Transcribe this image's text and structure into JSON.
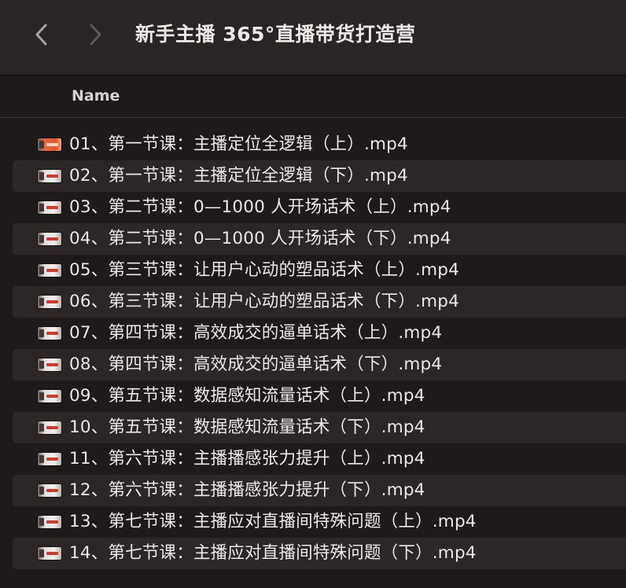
{
  "window": {
    "title": "新手主播 365°直播带货打造营"
  },
  "toolbar": {
    "back_icon": "chevron-left-icon",
    "forward_icon": "chevron-right-icon"
  },
  "columns": {
    "name_label": "Name"
  },
  "files": [
    {
      "name": "01、第一节课：主播定位全逻辑（上）.mp4"
    },
    {
      "name": "02、第一节课：主播定位全逻辑（下）.mp4"
    },
    {
      "name": "03、第二节课：0—1000 人开场话术（上）.mp4"
    },
    {
      "name": "04、第二节课：0—1000 人开场话术（下）.mp4"
    },
    {
      "name": "05、第三节课：让用户心动的塑品话术（上）.mp4"
    },
    {
      "name": "06、第三节课：让用户心动的塑品话术（下）.mp4"
    },
    {
      "name": "07、第四节课：高效成交的逼单话术（上）.mp4"
    },
    {
      "name": "08、第四节课：高效成交的逼单话术（下）.mp4"
    },
    {
      "name": "09、第五节课：数据感知流量话术（上）.mp4"
    },
    {
      "name": "10、第五节课：数据感知流量话术（下）.mp4"
    },
    {
      "name": "11、第六节课：主播播感张力提升（上）.mp4"
    },
    {
      "name": "12、第六节课：主播播感张力提升（下）.mp4"
    },
    {
      "name": "13、第七节课：主播应对直播间特殊问题（上）.mp4"
    },
    {
      "name": "14、第七节课：主播应对直播间特殊问题（下）.mp4"
    }
  ],
  "colors": {
    "background": "#1f1a1a",
    "toolbar": "#2a2424",
    "stripe": "#2c2626",
    "text": "#ece8e6"
  }
}
